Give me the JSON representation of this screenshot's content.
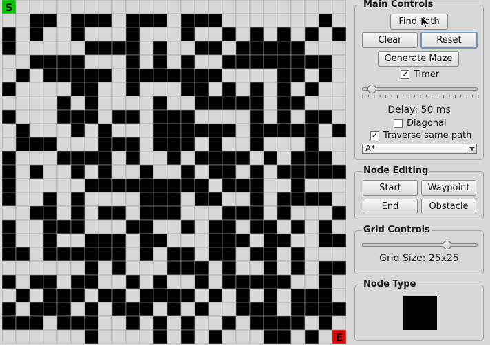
{
  "grid": {
    "size": 25,
    "start_label": "S",
    "end_label": "E",
    "start_cell": [
      0,
      0
    ],
    "end_cell": [
      24,
      24
    ],
    "rows": [
      "0000000000000000000000000",
      "0011011101110111000000010",
      "1010010001000100101010101",
      "1000001111010011011111000",
      "0011110001010100111111110",
      "0101111101111111000011010",
      "1000011001000110101010100",
      "0000101000010011111011000",
      "1000111011011100001010110",
      "0100010100011111101111101",
      "0111000111011101001000100",
      "1000111101001011110101110",
      "1010010100100101101011111",
      "1000001111111110111001000",
      "1001010000111011001011110",
      "0011010110111000111010001",
      "1001110001100101101101010",
      "1001001110110001110110011",
      "1101111110101101101101000",
      "0000001010001110100101011",
      "1011011001010010111110010",
      "0101110110111101010101110",
      "1011101011101010011101111",
      "1110111001010100101111010",
      "0000001000010101000110100"
    ]
  },
  "main_controls": {
    "title": "Main Controls",
    "find_path": "Find Path",
    "clear": "Clear",
    "reset": "Reset",
    "generate_maze": "Generate Maze",
    "timer_label": "Timer",
    "timer_checked": true,
    "delay_label": "Delay: 50 ms",
    "delay_value_ms": 50,
    "diagonal_label": "Diagonal",
    "diagonal_checked": false,
    "traverse_label": "Traverse same path",
    "traverse_checked": true,
    "algorithm_selected": "A*"
  },
  "node_editing": {
    "title": "Node Editing",
    "start": "Start",
    "waypoint": "Waypoint",
    "end": "End",
    "obstacle": "Obstacle"
  },
  "grid_controls": {
    "title": "Grid Controls",
    "grid_size_label": "Grid Size: 25x25",
    "grid_size_value": 25
  },
  "node_type": {
    "title": "Node Type",
    "swatch_color": "#000000"
  },
  "colors": {
    "wall": "#000000",
    "open": "#d8d8d8",
    "grid_line": "#a0a0a0",
    "start": "#00cc00",
    "end": "#dd0000"
  }
}
